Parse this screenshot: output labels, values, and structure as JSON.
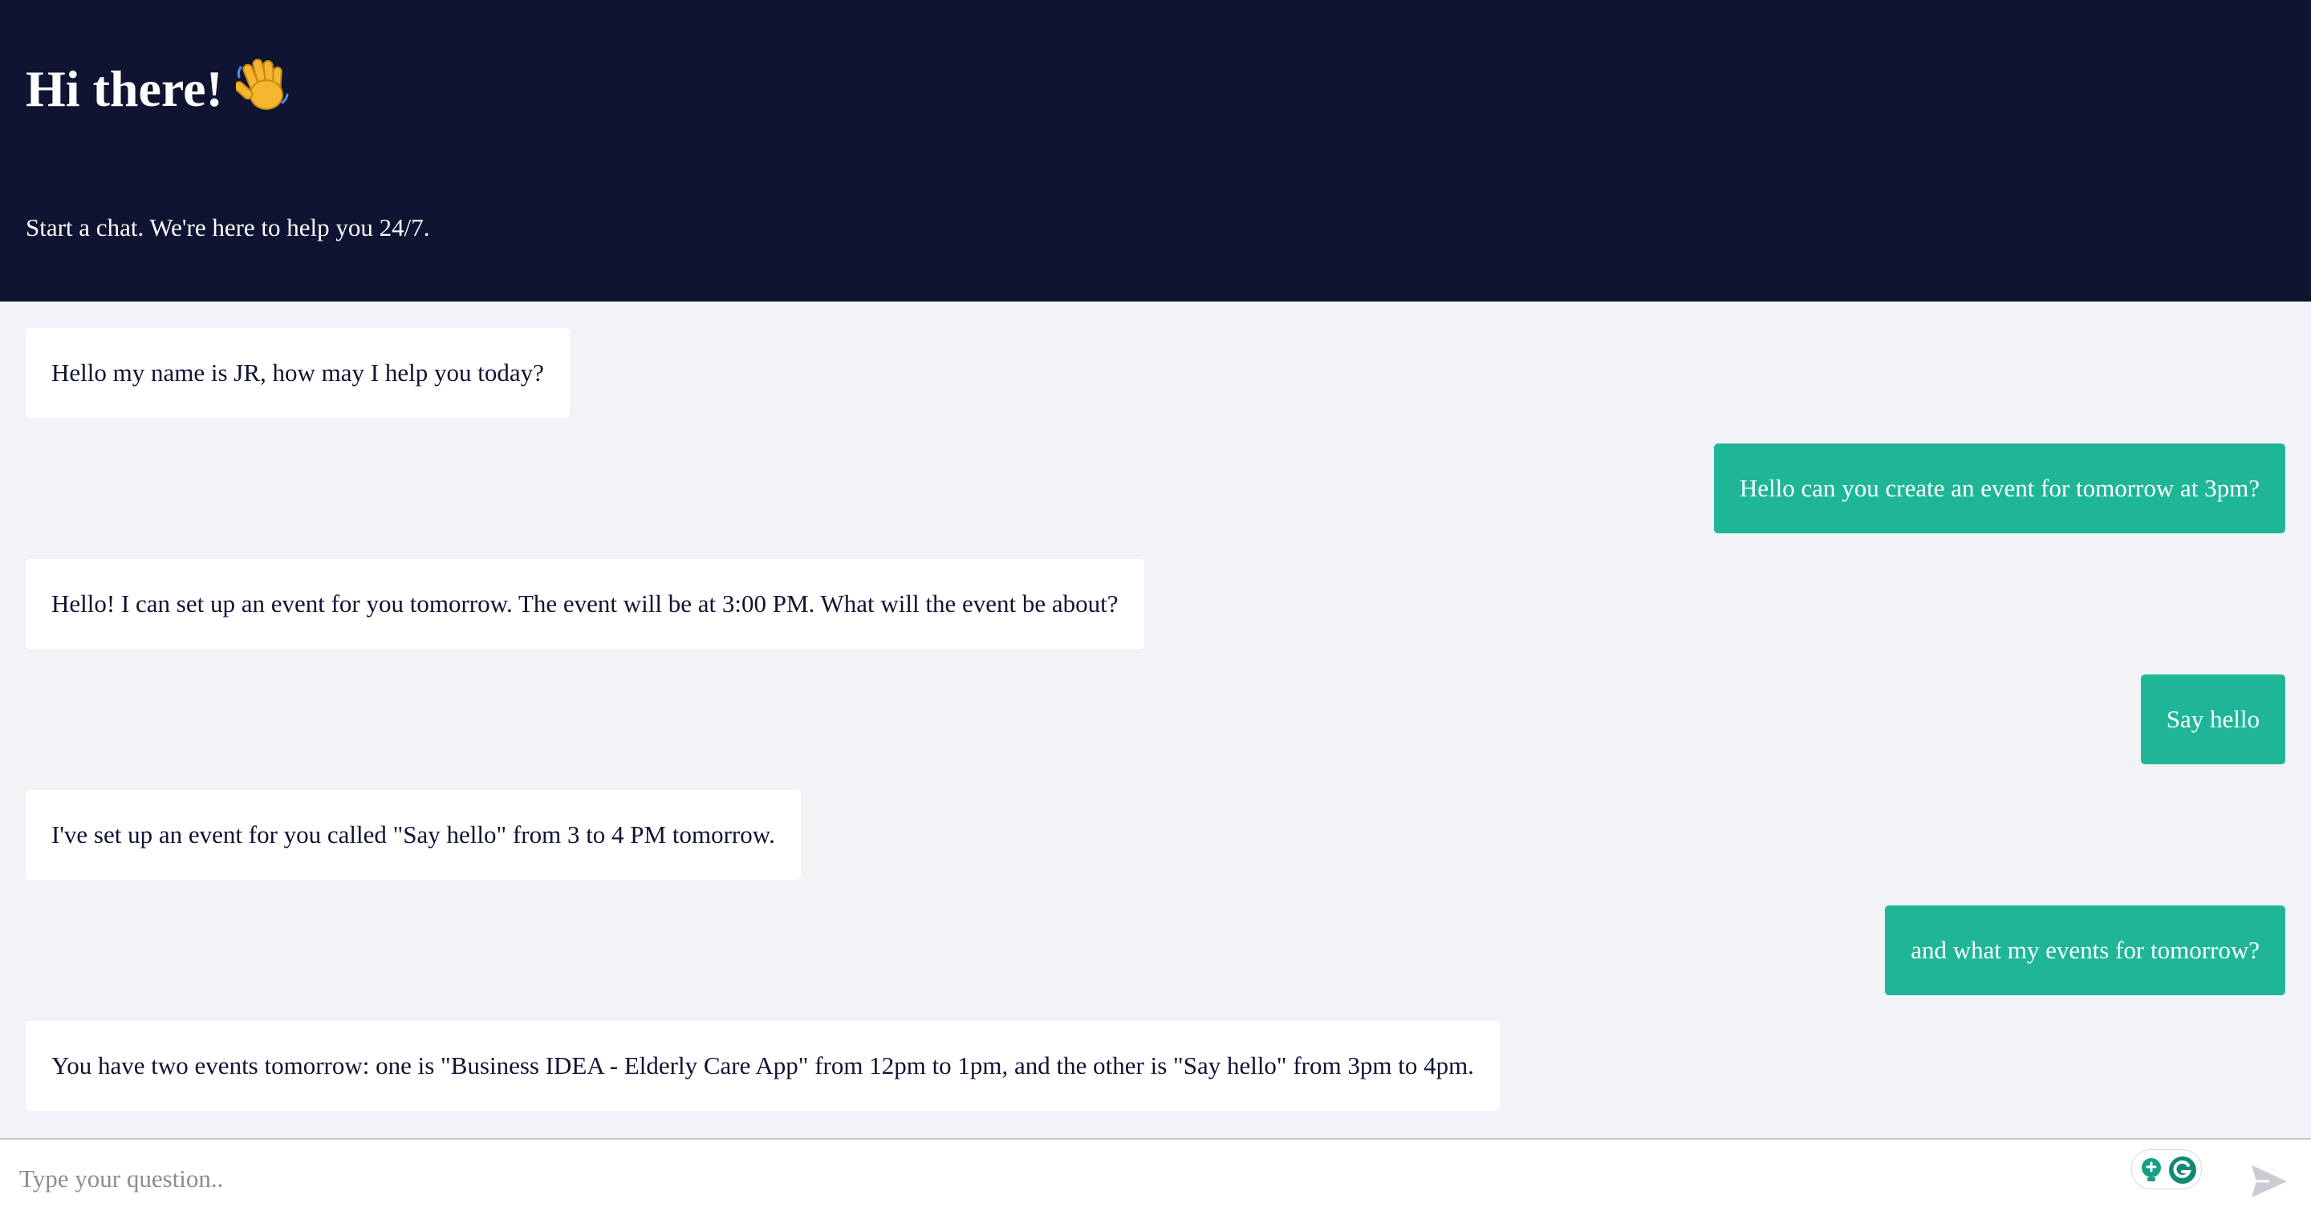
{
  "header": {
    "title": "Hi there!",
    "subtitle": "Start a chat. We're here to help you 24/7."
  },
  "messages": [
    {
      "role": "bot",
      "text": "Hello my name is JR, how may I help you today?"
    },
    {
      "role": "user",
      "text": "Hello can you create an event for tomorrow at 3pm?"
    },
    {
      "role": "bot",
      "text": "Hello! I can set up an event for you tomorrow. The event will be at 3:00 PM. What will the event be about?"
    },
    {
      "role": "user",
      "text": "Say hello"
    },
    {
      "role": "bot",
      "text": "I've set up an event for you called \"Say hello\" from 3 to 4 PM tomorrow."
    },
    {
      "role": "user",
      "text": "and what my events for tomorrow?"
    },
    {
      "role": "bot",
      "text": "You have two events tomorrow: one is \"Business IDEA - Elderly Care App\" from 12pm to 1pm, and the other is \"Say hello\" from 3pm to 4pm."
    }
  ],
  "composer": {
    "placeholder": "Type your question..",
    "value": ""
  },
  "icons": {
    "header_emoji": "waving-hand-icon",
    "extension": "grammarly-icon",
    "send": "send-icon"
  },
  "colors": {
    "header_bg": "#0f1432",
    "user_bubble": "#1fb698",
    "bot_bubble": "#ffffff",
    "page_bg": "#f2f3f7"
  }
}
